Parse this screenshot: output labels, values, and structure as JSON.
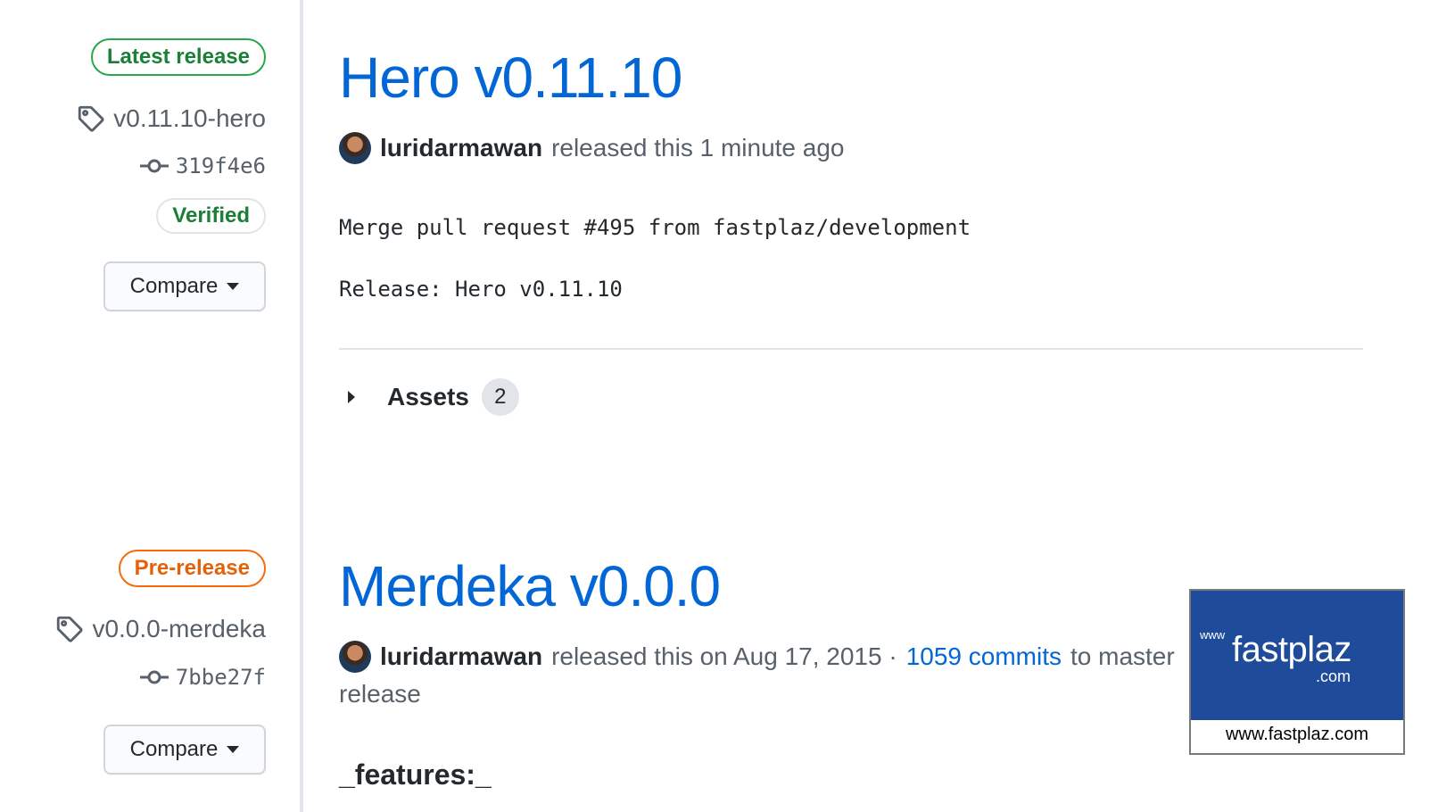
{
  "releases": [
    {
      "badge": "Latest release",
      "tag": "v0.11.10-hero",
      "commit": "319f4e6",
      "verified": "Verified",
      "compare_label": "Compare",
      "title": "Hero v0.11.10",
      "author": "luridarmawan",
      "released_text": "released this 1 minute ago",
      "body_line1": "Merge pull request #495 from fastplaz/development",
      "body_line2": "Release: Hero v0.11.10",
      "assets_label": "Assets",
      "assets_count": "2"
    },
    {
      "badge": "Pre-release",
      "tag": "v0.0.0-merdeka",
      "commit": "7bbe27f",
      "compare_label": "Compare",
      "title": "Merdeka v0.0.0",
      "author": "luridarmawan",
      "released_text": "released this on Aug 17, 2015 ·",
      "commits_link": "1059 commits",
      "to_branch": "to master",
      "release_word": "release",
      "features_heading": "_features:_"
    }
  ],
  "watermark": {
    "www": "www",
    "name": "fastplaz",
    "com": ".com",
    "url": "www.fastplaz.com"
  }
}
